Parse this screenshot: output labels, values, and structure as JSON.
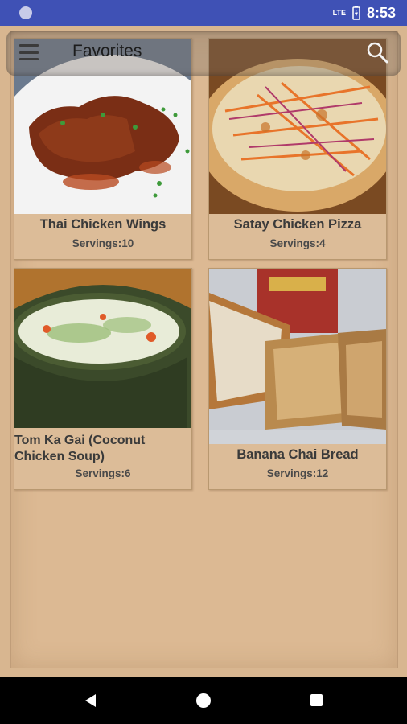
{
  "status_bar": {
    "time": "8:53",
    "network": "LTE",
    "icons": [
      "notification-dot-icon",
      "signal-icon",
      "battery-icon"
    ]
  },
  "app_bar": {
    "title": "Favorites",
    "menu_icon": "hamburger-menu-icon",
    "search_icon": "search-icon"
  },
  "recipes": [
    {
      "title": "Thai Chicken Wings",
      "servings": "Servings:10",
      "image": "chicken-wings-photo"
    },
    {
      "title": "Satay Chicken Pizza",
      "servings": "Servings:4",
      "image": "pizza-photo"
    },
    {
      "title": "Tom Ka Gai (Coconut Chicken Soup)",
      "servings": "Servings:6",
      "image": "soup-photo"
    },
    {
      "title": "Banana Chai Bread",
      "servings": "Servings:12",
      "image": "bread-photo"
    }
  ],
  "nav_bar": {
    "icons": [
      "back-icon",
      "home-icon",
      "recents-icon"
    ]
  }
}
